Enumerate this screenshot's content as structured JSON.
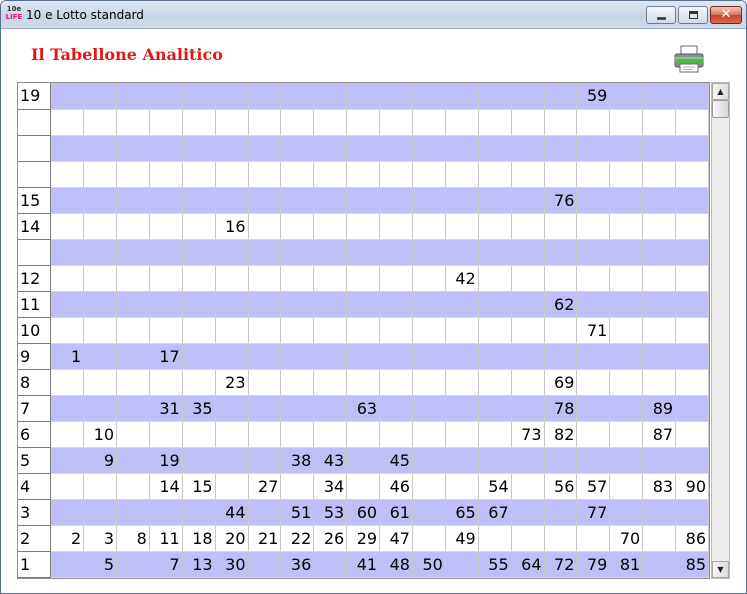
{
  "window": {
    "icon_top": "10e",
    "icon_bottom": "LIFE",
    "title": "10 e Lotto standard",
    "close_glyph": "✕"
  },
  "heading": "Il Tabellone Analitico",
  "print_icon": "printer-icon",
  "colors": {
    "band": "#bfbff8",
    "heading": "#e01818"
  },
  "scrollbar": {
    "up": "▲",
    "down": "▼"
  },
  "table": {
    "rows": [
      {
        "label": "19",
        "cells": [
          "",
          "",
          "",
          "",
          "",
          "",
          "",
          "",
          "",
          "",
          "",
          "",
          "",
          "",
          "",
          "",
          "59",
          "",
          "",
          ""
        ]
      },
      {
        "label": "",
        "cells": [
          "",
          "",
          "",
          "",
          "",
          "",
          "",
          "",
          "",
          "",
          "",
          "",
          "",
          "",
          "",
          "",
          "",
          "",
          "",
          ""
        ]
      },
      {
        "label": "",
        "cells": [
          "",
          "",
          "",
          "",
          "",
          "",
          "",
          "",
          "",
          "",
          "",
          "",
          "",
          "",
          "",
          "",
          "",
          "",
          "",
          ""
        ]
      },
      {
        "label": "",
        "cells": [
          "",
          "",
          "",
          "",
          "",
          "",
          "",
          "",
          "",
          "",
          "",
          "",
          "",
          "",
          "",
          "",
          "",
          "",
          "",
          ""
        ]
      },
      {
        "label": "15",
        "cells": [
          "",
          "",
          "",
          "",
          "",
          "",
          "",
          "",
          "",
          "",
          "",
          "",
          "",
          "",
          "",
          "76",
          "",
          "",
          "",
          ""
        ]
      },
      {
        "label": "14",
        "cells": [
          "",
          "",
          "",
          "",
          "",
          "16",
          "",
          "",
          "",
          "",
          "",
          "",
          "",
          "",
          "",
          "",
          "",
          "",
          "",
          ""
        ]
      },
      {
        "label": "",
        "cells": [
          "",
          "",
          "",
          "",
          "",
          "",
          "",
          "",
          "",
          "",
          "",
          "",
          "",
          "",
          "",
          "",
          "",
          "",
          "",
          ""
        ]
      },
      {
        "label": "12",
        "cells": [
          "",
          "",
          "",
          "",
          "",
          "",
          "",
          "",
          "",
          "",
          "",
          "",
          "42",
          "",
          "",
          "",
          "",
          "",
          "",
          ""
        ]
      },
      {
        "label": "11",
        "cells": [
          "",
          "",
          "",
          "",
          "",
          "",
          "",
          "",
          "",
          "",
          "",
          "",
          "",
          "",
          "",
          "62",
          "",
          "",
          "",
          ""
        ]
      },
      {
        "label": "10",
        "cells": [
          "",
          "",
          "",
          "",
          "",
          "",
          "",
          "",
          "",
          "",
          "",
          "",
          "",
          "",
          "",
          "",
          "71",
          "",
          "",
          ""
        ]
      },
      {
        "label": "9",
        "cells": [
          "1",
          "",
          "",
          "17",
          "",
          "",
          "",
          "",
          "",
          "",
          "",
          "",
          "",
          "",
          "",
          "",
          "",
          "",
          "",
          ""
        ]
      },
      {
        "label": "8",
        "cells": [
          "",
          "",
          "",
          "",
          "",
          "23",
          "",
          "",
          "",
          "",
          "",
          "",
          "",
          "",
          "",
          "69",
          "",
          "",
          "",
          ""
        ]
      },
      {
        "label": "7",
        "cells": [
          "",
          "",
          "",
          "31",
          "35",
          "",
          "",
          "",
          "",
          "63",
          "",
          "",
          "",
          "",
          "",
          "78",
          "",
          "",
          "89",
          ""
        ]
      },
      {
        "label": "6",
        "cells": [
          "",
          "10",
          "",
          "",
          "",
          "",
          "",
          "",
          "",
          "",
          "",
          "",
          "",
          "",
          "73",
          "82",
          "",
          "",
          "87",
          ""
        ]
      },
      {
        "label": "5",
        "cells": [
          "",
          "9",
          "",
          "19",
          "",
          "",
          "",
          "38",
          "43",
          "",
          "45",
          "",
          "",
          "",
          "",
          "",
          "",
          "",
          "",
          ""
        ]
      },
      {
        "label": "4",
        "cells": [
          "",
          "",
          "",
          "14",
          "15",
          "",
          "27",
          "",
          "34",
          "",
          "46",
          "",
          "",
          "54",
          "",
          "56",
          "57",
          "",
          "83",
          "90"
        ]
      },
      {
        "label": "3",
        "cells": [
          "",
          "",
          "",
          "",
          "",
          "44",
          "",
          "51",
          "53",
          "60",
          "61",
          "",
          "65",
          "67",
          "",
          "",
          "77",
          "",
          "",
          ""
        ]
      },
      {
        "label": "2",
        "cells": [
          "2",
          "3",
          "8",
          "11",
          "18",
          "20",
          "21",
          "22",
          "26",
          "29",
          "47",
          "",
          "49",
          "",
          "",
          "",
          "",
          "70",
          "",
          "86"
        ]
      },
      {
        "label": "1",
        "cells": [
          "",
          "5",
          "",
          "7",
          "13",
          "30",
          "",
          "36",
          "",
          "41",
          "48",
          "50",
          "",
          "55",
          "64",
          "72",
          "79",
          "81",
          "",
          "85"
        ]
      }
    ]
  }
}
